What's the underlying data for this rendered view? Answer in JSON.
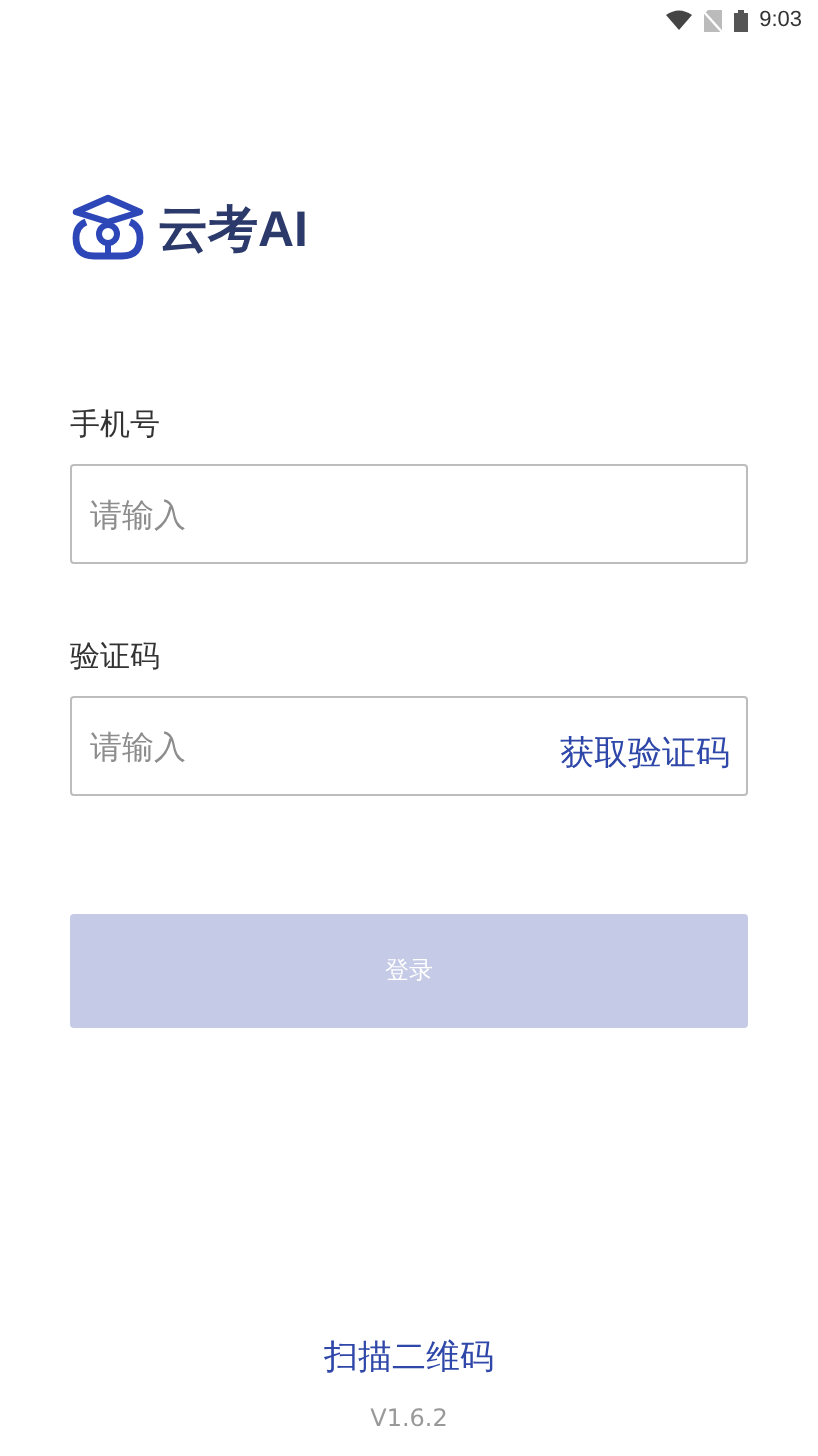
{
  "status_bar": {
    "time": "9:03"
  },
  "logo": {
    "text": "云考AI"
  },
  "fields": [
    {
      "label": "手机号",
      "placeholder": "请输入"
    },
    {
      "label": "验证码",
      "placeholder": "请输入",
      "action": "获取验证码"
    }
  ],
  "login_button": {
    "label": "登录",
    "disabled": true
  },
  "scan_link": "扫描二维码",
  "version": "V1.6.2"
}
